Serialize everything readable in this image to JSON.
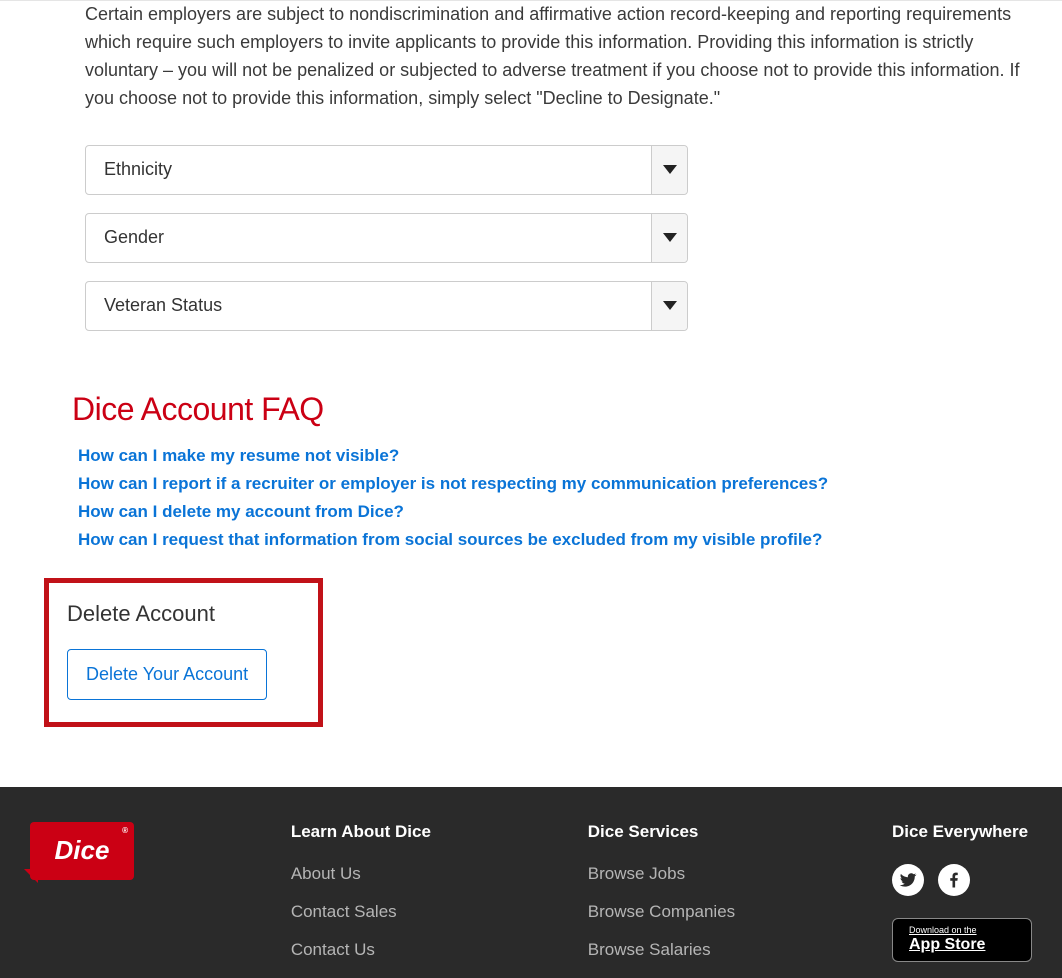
{
  "intro_paragraph": "Certain employers are subject to nondiscrimination and affirmative action record-keeping and reporting requirements which require such employers to invite applicants to provide this information. Providing this information is strictly voluntary – you will not be penalized or subjected to adverse treatment if you choose not to provide this information. If you choose not to provide this information, simply select \"Decline to Designate.\"",
  "selects": {
    "ethnicity": "Ethnicity",
    "gender": "Gender",
    "veteran": "Veteran Status"
  },
  "faq": {
    "heading": "Dice Account FAQ",
    "items": [
      "How can I make my resume not visible?",
      "How can I report if a recruiter or employer is not respecting my communication preferences?",
      "How can I delete my account from Dice?",
      "How can I request that information from social sources be excluded from my visible profile?"
    ]
  },
  "delete_section": {
    "heading": "Delete Account",
    "button": "Delete Your Account"
  },
  "footer": {
    "logo_text": "Dice",
    "logo_reg": "®",
    "col_learn": {
      "heading": "Learn About Dice",
      "links": [
        "About Us",
        "Contact Sales",
        "Contact Us"
      ]
    },
    "col_services": {
      "heading": "Dice Services",
      "links": [
        "Browse Jobs",
        "Browse Companies",
        "Browse Salaries"
      ]
    },
    "col_everywhere": {
      "heading": "Dice Everywhere",
      "appstore_small": "Download on the",
      "appstore_big": "App Store"
    }
  }
}
